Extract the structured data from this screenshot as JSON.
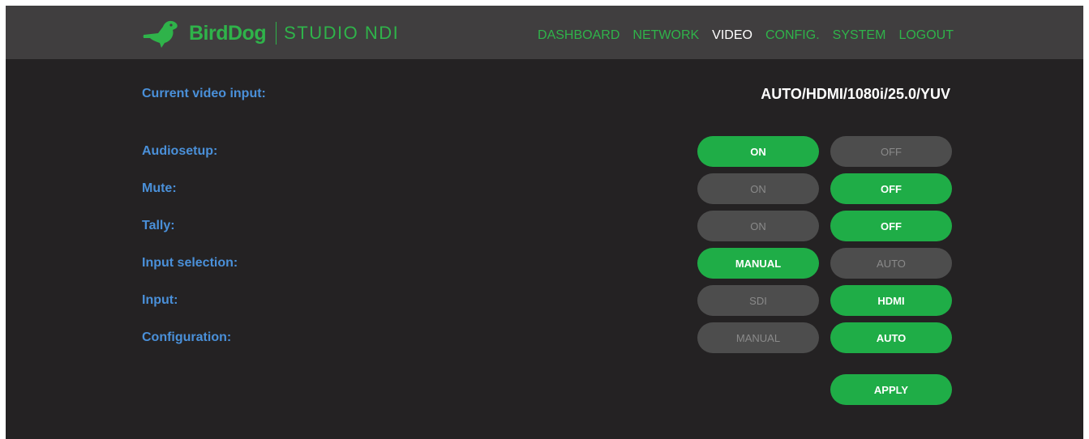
{
  "header": {
    "brand": "BirdDog",
    "product": "STUDIO NDI",
    "nav": [
      {
        "label": "DASHBOARD",
        "active": false
      },
      {
        "label": "NETWORK",
        "active": false
      },
      {
        "label": "VIDEO",
        "active": true
      },
      {
        "label": "CONFIG.",
        "active": false
      },
      {
        "label": "SYSTEM",
        "active": false
      },
      {
        "label": "LOGOUT",
        "active": false
      }
    ]
  },
  "current_input": {
    "label": "Current video input:",
    "value": "AUTO/HDMI/1080i/25.0/YUV"
  },
  "settings": [
    {
      "label": "Audiosetup:",
      "option_a": "ON",
      "option_b": "OFF",
      "selected": "a"
    },
    {
      "label": "Mute:",
      "option_a": "ON",
      "option_b": "OFF",
      "selected": "b"
    },
    {
      "label": "Tally:",
      "option_a": "ON",
      "option_b": "OFF",
      "selected": "b"
    },
    {
      "label": "Input selection:",
      "option_a": "MANUAL",
      "option_b": "AUTO",
      "selected": "a"
    },
    {
      "label": "Input:",
      "option_a": "SDI",
      "option_b": "HDMI",
      "selected": "b"
    },
    {
      "label": "Configuration:",
      "option_a": "MANUAL",
      "option_b": "AUTO",
      "selected": "b"
    }
  ],
  "apply_label": "APPLY",
  "colors": {
    "accent_green": "#1fad47",
    "label_blue": "#4a90d9",
    "inactive_gray": "#4d4d4d",
    "background": "#242223",
    "header": "#403e3f"
  }
}
